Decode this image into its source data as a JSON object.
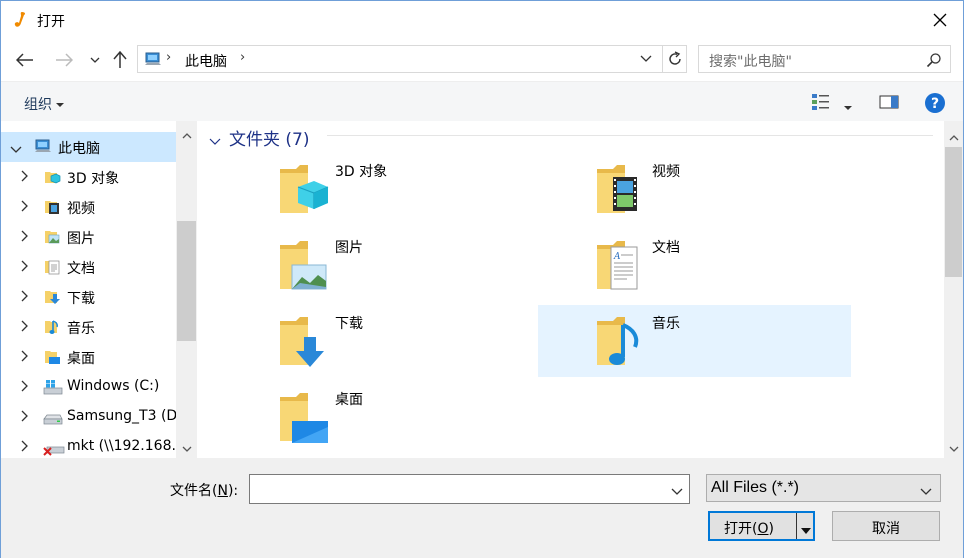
{
  "window": {
    "title": "打开"
  },
  "address": {
    "location": "此电脑",
    "search_placeholder": "搜索\"此电脑\""
  },
  "toolbar": {
    "organize_label": "组织"
  },
  "nav_tree": {
    "items": [
      {
        "label": "此电脑",
        "icon": "pc-icon"
      },
      {
        "label": "3D 对象",
        "icon": "3d-objects-icon"
      },
      {
        "label": "视频",
        "icon": "videos-icon"
      },
      {
        "label": "图片",
        "icon": "pictures-icon"
      },
      {
        "label": "文档",
        "icon": "documents-icon"
      },
      {
        "label": "下载",
        "icon": "downloads-icon"
      },
      {
        "label": "音乐",
        "icon": "music-icon"
      },
      {
        "label": "桌面",
        "icon": "desktop-icon"
      },
      {
        "label": "Windows (C:)",
        "icon": "windows-drive-icon"
      },
      {
        "label": "Samsung_T3 (D",
        "icon": "usb-drive-icon"
      },
      {
        "label": "mkt (\\\\192.168.",
        "icon": "network-drive-disconnected-icon"
      }
    ]
  },
  "main": {
    "group_title": "文件夹 (7)",
    "folders": [
      {
        "label": "3D 对象",
        "icon": "3d-objects-folder-icon"
      },
      {
        "label": "视频",
        "icon": "videos-folder-icon"
      },
      {
        "label": "图片",
        "icon": "pictures-folder-icon"
      },
      {
        "label": "文档",
        "icon": "documents-folder-icon"
      },
      {
        "label": "下载",
        "icon": "downloads-folder-icon"
      },
      {
        "label": "音乐",
        "icon": "music-folder-icon",
        "selected": true
      },
      {
        "label": "桌面",
        "icon": "desktop-folder-icon"
      }
    ]
  },
  "footer": {
    "filename_label": "文件名(",
    "filename_key": "N",
    "filename_label_end": "):",
    "filename_value": "",
    "filetype_value": "All Files (*.*)",
    "open_label": "打开(",
    "open_key": "O",
    "open_label_end": ")",
    "cancel_label": "取消"
  },
  "colors": {
    "accent": "#0078d7",
    "selection": "#cce8ff",
    "tile_selection": "#e5f3ff",
    "group_title": "#1e3287"
  }
}
